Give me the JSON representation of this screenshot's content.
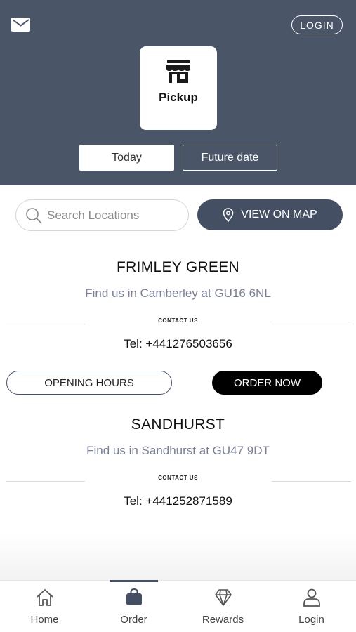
{
  "header": {
    "login_label": "LOGIN",
    "pickup_label": "Pickup",
    "date_options": {
      "today": "Today",
      "future": "Future date"
    },
    "background_color": "#4a5568"
  },
  "search": {
    "placeholder": "Search Locations",
    "value": "",
    "map_button_label": "VIEW ON MAP"
  },
  "locations": [
    {
      "name": "FRIMLEY GREEN",
      "subtitle": "Find us in Camberley at GU16 6NL",
      "contact_label": "CONTACT US",
      "tel": "Tel: +441276503656",
      "hours_button": "OPENING HOURS",
      "order_button": "ORDER NOW"
    },
    {
      "name": "SANDHURST",
      "subtitle": "Find us in Sandhurst at GU47 9DT",
      "contact_label": "CONTACT US",
      "tel": "Tel: +441252871589"
    }
  ],
  "tabbar": {
    "items": [
      {
        "label": "Home",
        "icon": "home-icon"
      },
      {
        "label": "Order",
        "icon": "bag-icon",
        "active": true
      },
      {
        "label": "Rewards",
        "icon": "diamond-icon"
      },
      {
        "label": "Login",
        "icon": "user-icon"
      }
    ],
    "accent_color": "#454f63"
  }
}
